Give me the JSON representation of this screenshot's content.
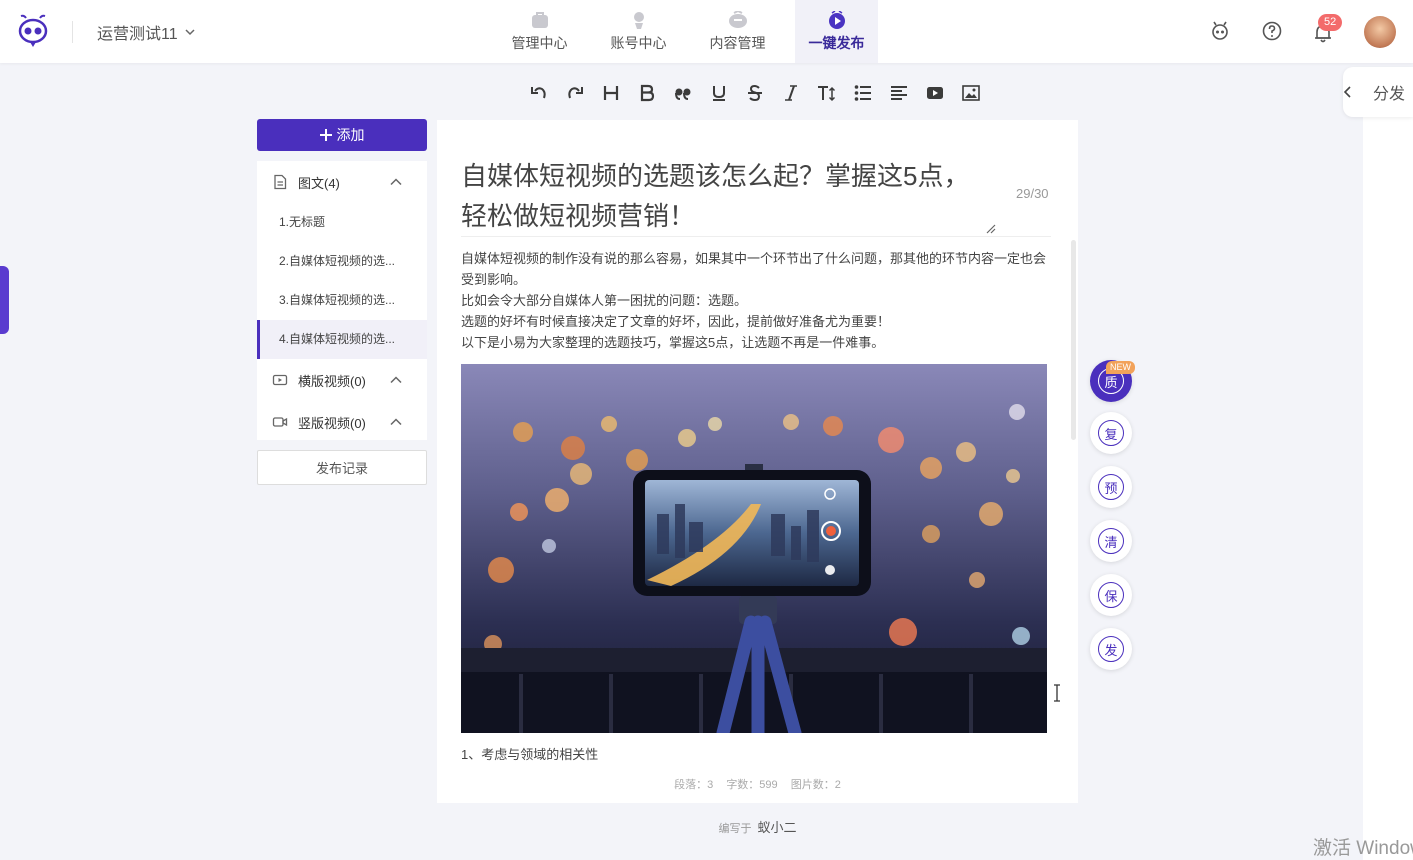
{
  "header": {
    "workspace": "运营测试11",
    "nav": [
      {
        "label": "管理中心",
        "icon": "bag-icon"
      },
      {
        "label": "账号中心",
        "icon": "user-icon"
      },
      {
        "label": "内容管理",
        "icon": "content-icon"
      },
      {
        "label": "一键发布",
        "icon": "publish-icon",
        "active": true
      }
    ],
    "notification_count": "52"
  },
  "side_tab": {
    "label": "分发"
  },
  "sidebar": {
    "add_label": "添加",
    "categories": [
      {
        "label": "图文(4)",
        "expanded": true
      },
      {
        "label": "横版视频(0)",
        "expanded": false
      },
      {
        "label": "竖版视频(0)",
        "expanded": false
      }
    ],
    "docs": [
      "1.无标题",
      "2.自媒体短视频的选...",
      "3.自媒体短视频的选...",
      "4.自媒体短视频的选..."
    ],
    "active_doc": 3,
    "records_label": "发布记录"
  },
  "editor": {
    "title": "自媒体短视频的选题该怎么起？掌握这5点，轻松做短视频营销！",
    "title_count": "29/30",
    "body": [
      "自媒体短视频的制作没有说的那么容易，如果其中一个环节出了什么问题，那其他的环节内容一定也会受到影响。",
      "比如会令大部分自媒体人第一困扰的问题：选题。",
      "选题的好坏有时候直接决定了文章的好坏，因此，提前做好准备尤为重要！",
      "以下是小易为大家整理的选题技巧，掌握这5点，让选题不再是一件难事。"
    ],
    "after_image": "1、考虑与领域的相关性",
    "stats": {
      "paragraphs": "段落：3",
      "words": "字数：599",
      "images": "图片数：2"
    }
  },
  "author": {
    "prefix": "编写于",
    "name": "蚁小二"
  },
  "float_buttons": [
    {
      "label": "质",
      "primary": true,
      "tag": "NEW"
    },
    {
      "label": "复"
    },
    {
      "label": "预"
    },
    {
      "label": "清"
    },
    {
      "label": "保"
    },
    {
      "label": "发"
    }
  ],
  "watermark": "激活 Windows",
  "colors": {
    "accent": "#4a2fbd",
    "badge": "#f36b6b"
  }
}
